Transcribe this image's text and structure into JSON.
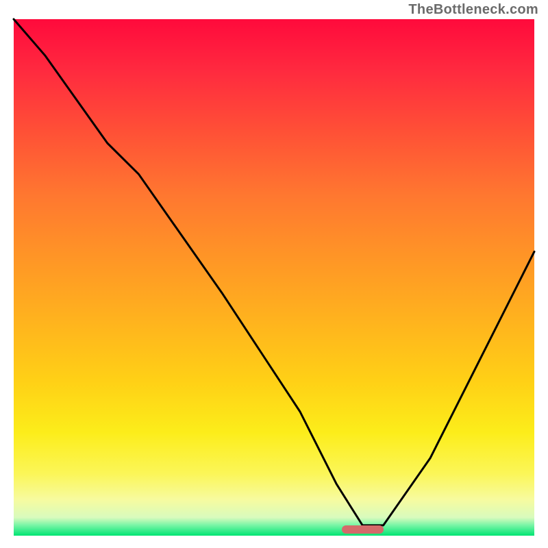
{
  "attribution": "TheBottleneck.com",
  "colors": {
    "gradient_top": "#ff0a3c",
    "gradient_bottom": "#00e472",
    "curve": "#000000",
    "marker": "#d46a6a"
  },
  "chart_data": {
    "type": "line",
    "title": "",
    "xlabel": "",
    "ylabel": "",
    "xlim": [
      0,
      100
    ],
    "ylim": [
      0,
      100
    ],
    "grid": false,
    "legend": false,
    "series": [
      {
        "name": "bottleneck-curve",
        "x": [
          0,
          6,
          18,
          24,
          40,
          55,
          62,
          67,
          71,
          80,
          90,
          100
        ],
        "values": [
          100,
          93,
          76,
          70,
          47,
          24,
          10,
          2,
          2,
          15,
          35,
          55
        ]
      }
    ],
    "marker": {
      "x_start": 63,
      "x_end": 71,
      "y": 1.2
    },
    "annotations": []
  }
}
